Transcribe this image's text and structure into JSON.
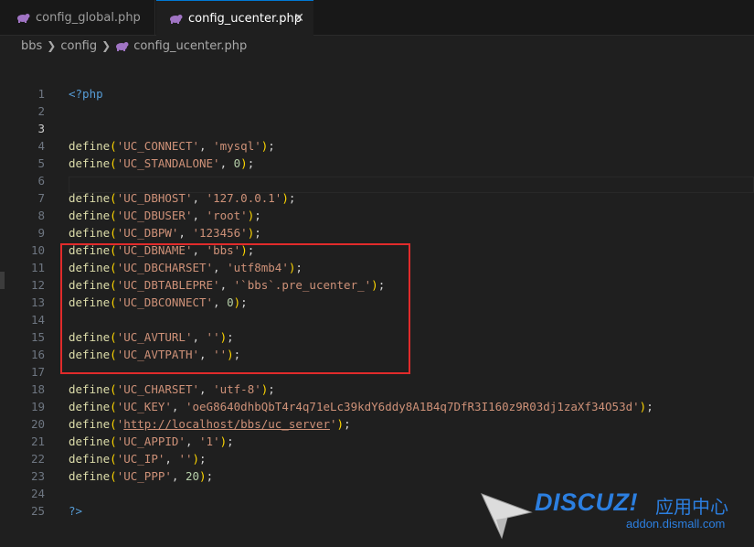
{
  "tabs": [
    {
      "label": "config_global.php",
      "active": false
    },
    {
      "label": "config_ucenter.php",
      "active": true
    }
  ],
  "breadcrumb": [
    "bbs",
    "config",
    "config_ucenter.php"
  ],
  "editor": {
    "active_line": 3,
    "highlighted_lines": [
      7,
      13
    ],
    "lines": [
      {
        "n": "1",
        "tokens": [
          [
            "<?php",
            "tag"
          ]
        ]
      },
      {
        "n": "2",
        "tokens": []
      },
      {
        "n": "3",
        "tokens": []
      },
      {
        "n": "4",
        "tokens": [
          [
            "define",
            "k"
          ],
          [
            "(",
            "b"
          ],
          [
            "'UC_CONNECT'",
            "s"
          ],
          [
            ", ",
            "p"
          ],
          [
            "'mysql'",
            "s"
          ],
          [
            ")",
            "b"
          ],
          [
            ";",
            "p"
          ]
        ]
      },
      {
        "n": "5",
        "tokens": [
          [
            "define",
            "k"
          ],
          [
            "(",
            "b"
          ],
          [
            "'UC_STANDALONE'",
            "s"
          ],
          [
            ", ",
            "p"
          ],
          [
            "0",
            "n"
          ],
          [
            ")",
            "b"
          ],
          [
            ";",
            "p"
          ]
        ]
      },
      {
        "n": "6",
        "tokens": []
      },
      {
        "n": "7",
        "tokens": [
          [
            "define",
            "k"
          ],
          [
            "(",
            "b"
          ],
          [
            "'UC_DBHOST'",
            "s"
          ],
          [
            ", ",
            "p"
          ],
          [
            "'127.0.0.1'",
            "s"
          ],
          [
            ")",
            "b"
          ],
          [
            ";",
            "p"
          ]
        ]
      },
      {
        "n": "8",
        "tokens": [
          [
            "define",
            "k"
          ],
          [
            "(",
            "b"
          ],
          [
            "'UC_DBUSER'",
            "s"
          ],
          [
            ", ",
            "p"
          ],
          [
            "'root'",
            "s"
          ],
          [
            ")",
            "b"
          ],
          [
            ";",
            "p"
          ]
        ]
      },
      {
        "n": "9",
        "tokens": [
          [
            "define",
            "k"
          ],
          [
            "(",
            "b"
          ],
          [
            "'UC_DBPW'",
            "s"
          ],
          [
            ", ",
            "p"
          ],
          [
            "'123456'",
            "s"
          ],
          [
            ")",
            "b"
          ],
          [
            ";",
            "p"
          ]
        ]
      },
      {
        "n": "10",
        "tokens": [
          [
            "define",
            "k"
          ],
          [
            "(",
            "b"
          ],
          [
            "'UC_DBNAME'",
            "s"
          ],
          [
            ", ",
            "p"
          ],
          [
            "'bbs'",
            "s"
          ],
          [
            ")",
            "b"
          ],
          [
            ";",
            "p"
          ]
        ]
      },
      {
        "n": "11",
        "tokens": [
          [
            "define",
            "k"
          ],
          [
            "(",
            "b"
          ],
          [
            "'UC_DBCHARSET'",
            "s"
          ],
          [
            ", ",
            "p"
          ],
          [
            "'utf8mb4'",
            "s"
          ],
          [
            ")",
            "b"
          ],
          [
            ";",
            "p"
          ]
        ]
      },
      {
        "n": "12",
        "tokens": [
          [
            "define",
            "k"
          ],
          [
            "(",
            "b"
          ],
          [
            "'UC_DBTABLEPRE'",
            "s"
          ],
          [
            ", ",
            "p"
          ],
          [
            "'`bbs`.pre_ucenter_'",
            "s"
          ],
          [
            ")",
            "b"
          ],
          [
            ";",
            "p"
          ]
        ]
      },
      {
        "n": "13",
        "tokens": [
          [
            "define",
            "k"
          ],
          [
            "(",
            "b"
          ],
          [
            "'UC_DBCONNECT'",
            "s"
          ],
          [
            ", ",
            "p"
          ],
          [
            "0",
            "n"
          ],
          [
            ")",
            "b"
          ],
          [
            ";",
            "p"
          ]
        ]
      },
      {
        "n": "14",
        "tokens": []
      },
      {
        "n": "15",
        "tokens": [
          [
            "define",
            "k"
          ],
          [
            "(",
            "b"
          ],
          [
            "'UC_AVTURL'",
            "s"
          ],
          [
            ", ",
            "p"
          ],
          [
            "''",
            "s"
          ],
          [
            ")",
            "b"
          ],
          [
            ";",
            "p"
          ]
        ]
      },
      {
        "n": "16",
        "tokens": [
          [
            "define",
            "k"
          ],
          [
            "(",
            "b"
          ],
          [
            "'UC_AVTPATH'",
            "s"
          ],
          [
            ", ",
            "p"
          ],
          [
            "''",
            "s"
          ],
          [
            ")",
            "b"
          ],
          [
            ";",
            "p"
          ]
        ]
      },
      {
        "n": "17",
        "tokens": []
      },
      {
        "n": "18",
        "tokens": [
          [
            "define",
            "k"
          ],
          [
            "(",
            "b"
          ],
          [
            "'UC_CHARSET'",
            "s"
          ],
          [
            ", ",
            "p"
          ],
          [
            "'utf-8'",
            "s"
          ],
          [
            ")",
            "b"
          ],
          [
            ";",
            "p"
          ]
        ]
      },
      {
        "n": "19",
        "tokens": [
          [
            "define",
            "k"
          ],
          [
            "(",
            "b"
          ],
          [
            "'UC_KEY'",
            "s"
          ],
          [
            ", ",
            "p"
          ],
          [
            "'oeG8640dhbQbT4r4q71eLc39kdY6ddy8A1B4q7DfR3I160z9R03dj1zaXf34O53d'",
            "s"
          ],
          [
            ")",
            "b"
          ],
          [
            ";",
            "p"
          ]
        ]
      },
      {
        "n": "20",
        "tokens": [
          [
            "define",
            "k"
          ],
          [
            "(",
            "b"
          ],
          [
            "'",
            "s"
          ],
          [
            "http://localhost/bbs/uc_server",
            "s url"
          ],
          [
            "'",
            "s"
          ],
          [
            ")",
            "b"
          ],
          [
            ";",
            "p"
          ]
        ]
      },
      {
        "n": "21",
        "tokens": [
          [
            "define",
            "k"
          ],
          [
            "(",
            "b"
          ],
          [
            "'UC_APPID'",
            "s"
          ],
          [
            ", ",
            "p"
          ],
          [
            "'1'",
            "s"
          ],
          [
            ")",
            "b"
          ],
          [
            ";",
            "p"
          ]
        ]
      },
      {
        "n": "22",
        "tokens": [
          [
            "define",
            "k"
          ],
          [
            "(",
            "b"
          ],
          [
            "'UC_IP'",
            "s"
          ],
          [
            ", ",
            "p"
          ],
          [
            "''",
            "s"
          ],
          [
            ")",
            "b"
          ],
          [
            ";",
            "p"
          ]
        ]
      },
      {
        "n": "23",
        "tokens": [
          [
            "define",
            "k"
          ],
          [
            "(",
            "b"
          ],
          [
            "'UC_PPP'",
            "s"
          ],
          [
            ", ",
            "p"
          ],
          [
            "20",
            "n"
          ],
          [
            ")",
            "b"
          ],
          [
            ";",
            "p"
          ]
        ]
      },
      {
        "n": "24",
        "tokens": []
      },
      {
        "n": "25",
        "tokens": [
          [
            "?>",
            "tag"
          ]
        ]
      }
    ]
  },
  "watermark": {
    "logo": "DISCUZ!",
    "cn": "应用中心",
    "url": "addon.dismall.com"
  },
  "colors": {
    "background": "#1f1f1f",
    "keyword": "#dcdcaa",
    "string": "#ce9178",
    "number": "#b5cea8",
    "bracket": "#ffd700",
    "php_tag": "#569cd6",
    "highlight_border": "#e12b2b",
    "watermark": "#2c7fe0"
  }
}
